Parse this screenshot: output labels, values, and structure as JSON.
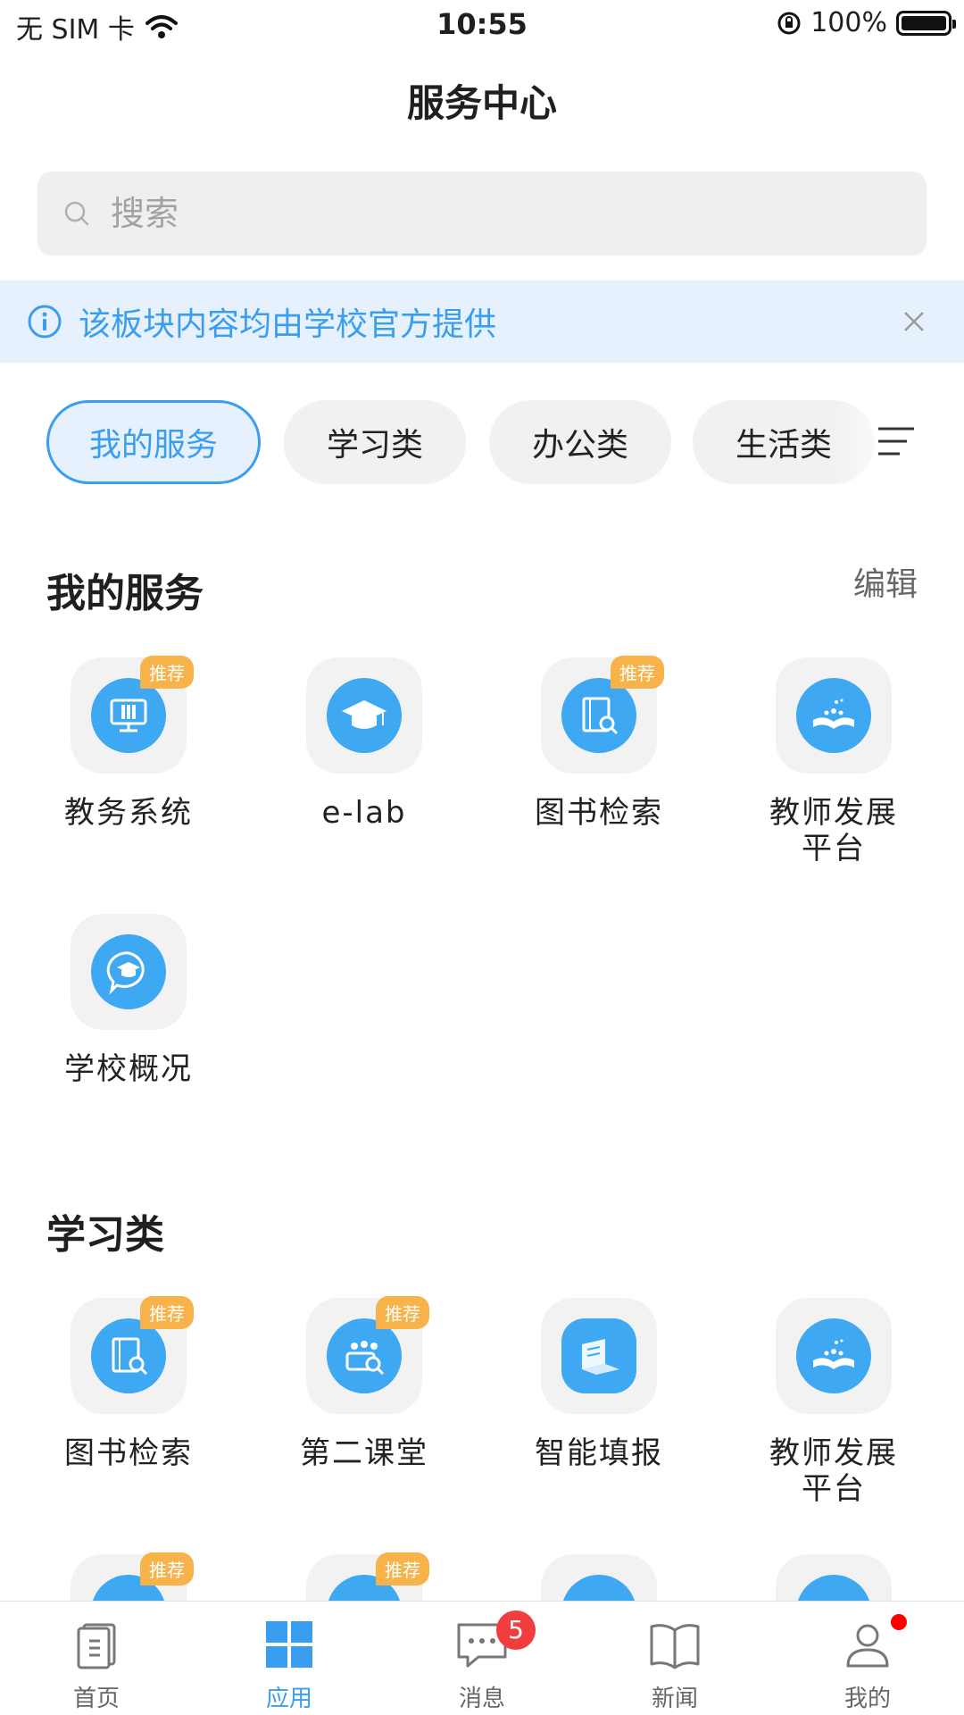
{
  "status": {
    "carrier": "无 SIM 卡",
    "time": "10:55",
    "battery": "100%"
  },
  "header": {
    "title": "服务中心"
  },
  "search": {
    "placeholder": "搜索"
  },
  "notice": {
    "text": "该板块内容均由学校官方提供"
  },
  "tabs": [
    {
      "label": "我的服务",
      "active": true
    },
    {
      "label": "学习类"
    },
    {
      "label": "办公类"
    },
    {
      "label": "生活类"
    }
  ],
  "my_services": {
    "title": "我的服务",
    "edit_label": "编辑",
    "items": [
      {
        "label": "教务系统",
        "badge": "推荐",
        "icon": "monitor-books-icon"
      },
      {
        "label": "e-lab",
        "icon": "graduation-cap-icon"
      },
      {
        "label": "图书检索",
        "badge": "推荐",
        "icon": "book-search-icon"
      },
      {
        "label": "教师发展\n平台",
        "icon": "open-book-people-icon"
      },
      {
        "label": "学校概况",
        "icon": "chat-graduation-icon"
      }
    ]
  },
  "study": {
    "title": "学习类",
    "items": [
      {
        "label": "图书检索",
        "badge": "推荐",
        "icon": "book-search-icon"
      },
      {
        "label": "第二课堂",
        "badge": "推荐",
        "icon": "group-search-icon"
      },
      {
        "label": "智能填报",
        "icon": "laptop-form-icon"
      },
      {
        "label": "教师发展\n平台",
        "icon": "open-book-people-icon"
      }
    ],
    "partial_badges": [
      "推荐",
      "推荐"
    ]
  },
  "tabbar": [
    {
      "label": "首页",
      "icon": "document-icon"
    },
    {
      "label": "应用",
      "icon": "grid-icon",
      "active": true
    },
    {
      "label": "消息",
      "icon": "chat-icon",
      "badge": "5"
    },
    {
      "label": "新闻",
      "icon": "open-book-icon"
    },
    {
      "label": "我的",
      "icon": "person-icon",
      "dot": true
    }
  ],
  "colors": {
    "accent": "#3a9ef0",
    "badge": "#f7b24a",
    "notice_bg": "#e6f1fd",
    "alert": "#f13d3d"
  }
}
